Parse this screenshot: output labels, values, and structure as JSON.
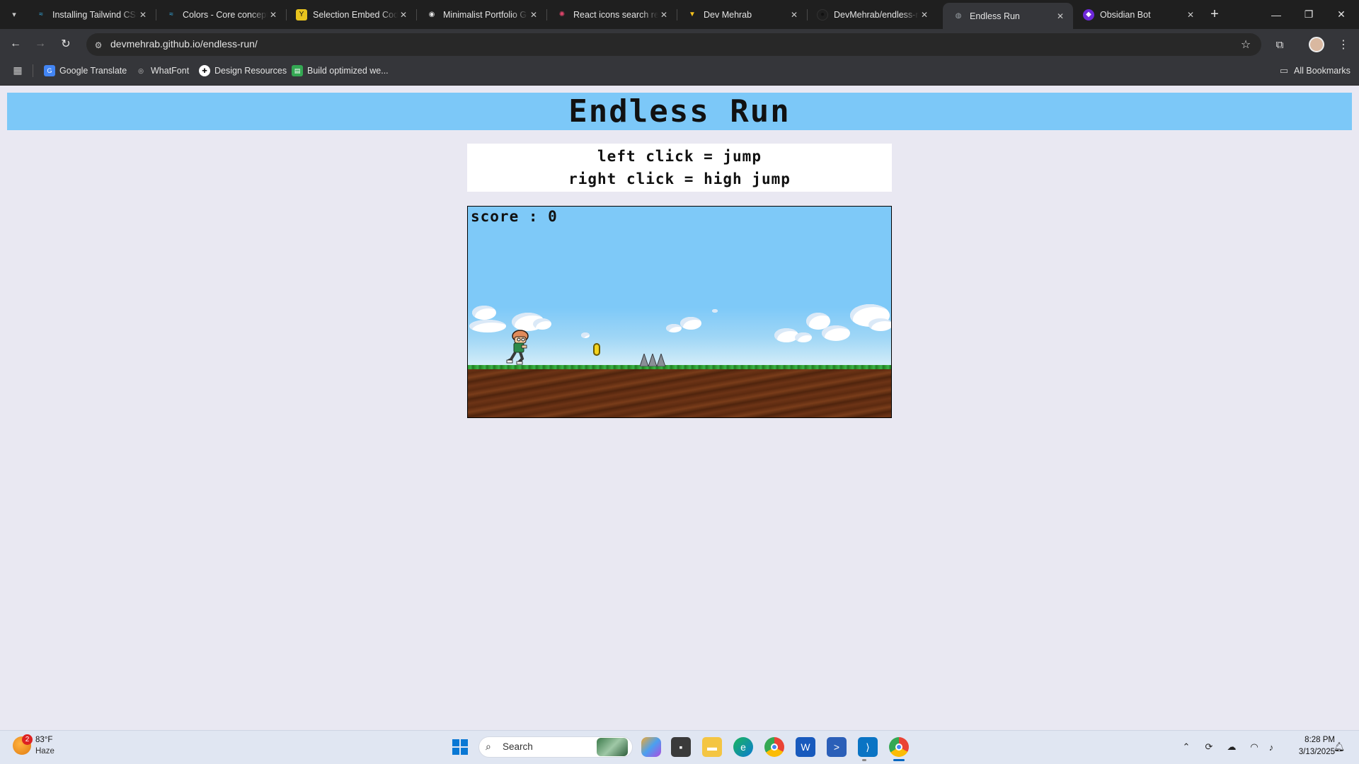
{
  "browser": {
    "tabs": [
      {
        "title": "Installing Tailwind CSS",
        "favicon": "tailwind-icon",
        "color": "#38bdf8"
      },
      {
        "title": "Colors - Core concepts",
        "favicon": "tailwind-icon",
        "color": "#38bdf8"
      },
      {
        "title": "Selection Embed Code",
        "favicon": "embed-icon",
        "color": "#e8c31e"
      },
      {
        "title": "Minimalist Portfolio G",
        "favicon": "github-icon",
        "color": "#e3e3e3"
      },
      {
        "title": "React icons search re",
        "favicon": "react-icons-icon",
        "color": "#e0456b"
      },
      {
        "title": "Dev Mehrab",
        "favicon": "vite-icon",
        "color": "#bd34fe"
      },
      {
        "title": "DevMehrab/endless-r",
        "favicon": "github-icon",
        "color": "#1f1f1f"
      },
      {
        "title": "Endless Run",
        "favicon": "globe-icon",
        "color": "#9aa0a6"
      },
      {
        "title": "Obsidian Bot",
        "favicon": "obsidian-icon",
        "color": "#7c3aed"
      }
    ],
    "active_tab_index": 7,
    "url": "devmehrab.github.io/endless-run/",
    "bookmarks": [
      {
        "label": "Google Translate",
        "icon": "translate-icon",
        "color": "#4285f4"
      },
      {
        "label": "WhatFont",
        "icon": "whatfont-icon",
        "color": "#555"
      },
      {
        "label": "Design Resources",
        "icon": "notion-icon",
        "color": "#111"
      },
      {
        "label": "Build optimized we...",
        "icon": "sheets-icon",
        "color": "#34a853"
      }
    ],
    "all_bookmarks_label": "All Bookmarks"
  },
  "game": {
    "title": "Endless Run",
    "instructions": [
      "left click = jump",
      "right click = high jump"
    ],
    "score_label": "score : 0",
    "colors": {
      "sky": "#7ec9f8",
      "header": "#7cc8f8",
      "ground": "#6d3416",
      "grass": "#2e9b2e",
      "coin": "#f4d41e"
    }
  },
  "taskbar": {
    "weather_temp": "83°F",
    "weather_desc": "Haze",
    "weather_badge": "2",
    "search_placeholder": "Search",
    "time": "8:28 PM",
    "date": "3/13/2025"
  }
}
